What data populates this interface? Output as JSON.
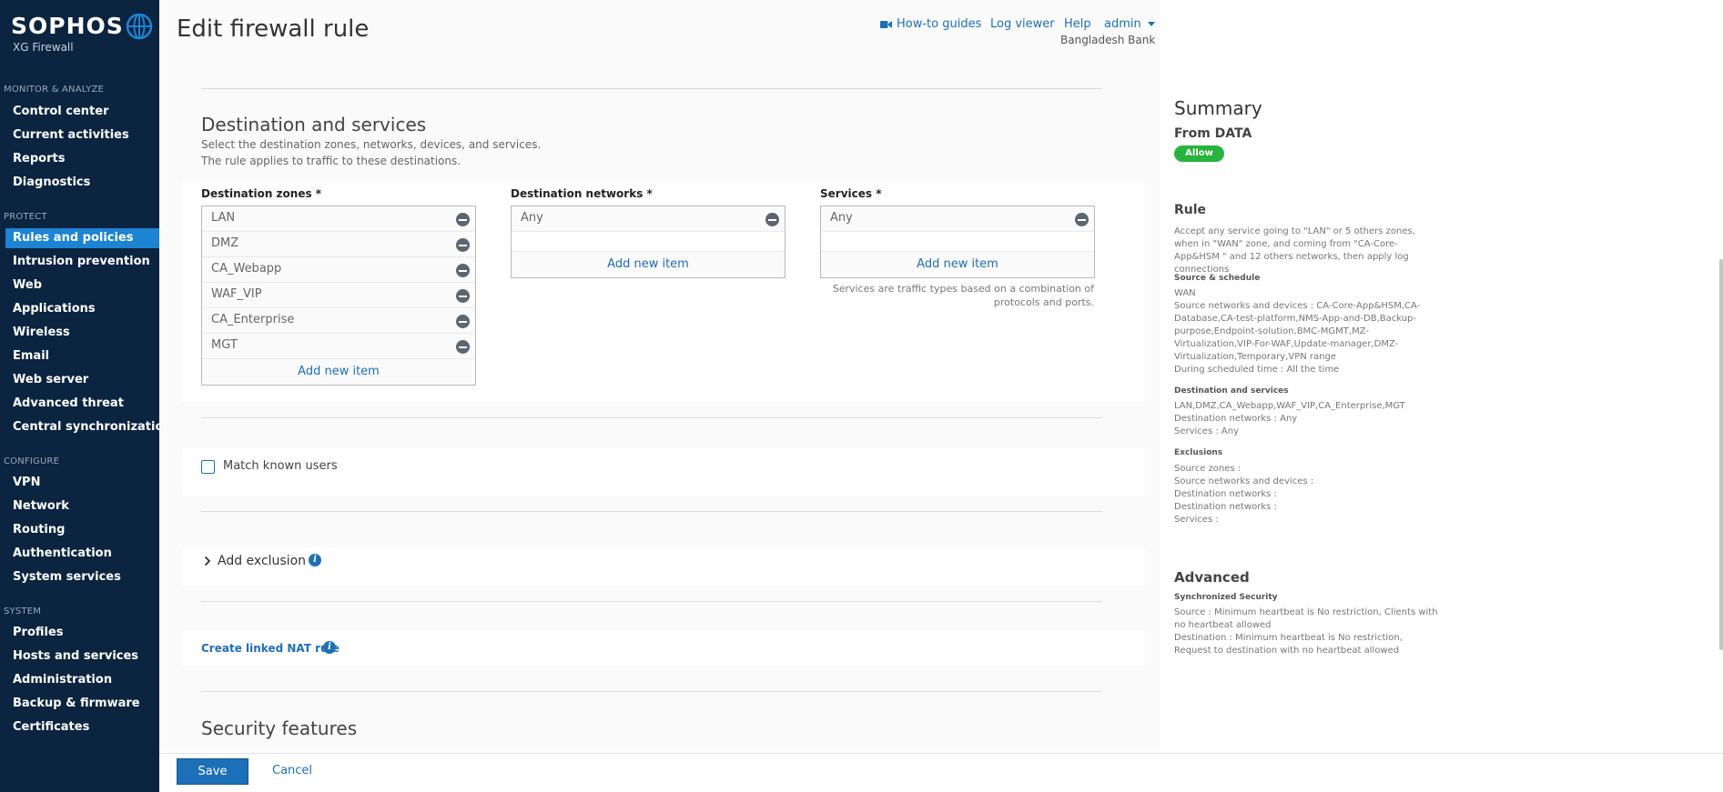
{
  "brand": {
    "name": "SOPHOS",
    "product": "XG Firewall"
  },
  "sidebar": {
    "sections": [
      {
        "label": "MONITOR & ANALYZE",
        "items": [
          "Control center",
          "Current activities",
          "Reports",
          "Diagnostics"
        ]
      },
      {
        "label": "PROTECT",
        "items": [
          "Rules and policies",
          "Intrusion prevention",
          "Web",
          "Applications",
          "Wireless",
          "Email",
          "Web server",
          "Advanced threat",
          "Central synchronization"
        ]
      },
      {
        "label": "CONFIGURE",
        "items": [
          "VPN",
          "Network",
          "Routing",
          "Authentication",
          "System services"
        ]
      },
      {
        "label": "SYSTEM",
        "items": [
          "Profiles",
          "Hosts and services",
          "Administration",
          "Backup & firmware",
          "Certificates"
        ]
      }
    ],
    "active": "Rules and policies"
  },
  "header": {
    "title": "Edit firewall rule",
    "links": {
      "guides": "How-to guides",
      "log": "Log viewer",
      "help": "Help",
      "user": "admin"
    },
    "org": "Bangladesh Bank"
  },
  "destination": {
    "title": "Destination and services",
    "desc1": "Select the destination zones, networks, devices, and services.",
    "desc2": "The rule applies to traffic to these destinations.",
    "zones_label": "Destination zones *",
    "zones": [
      "LAN",
      "DMZ",
      "CA_Webapp",
      "WAF_VIP",
      "CA_Enterprise",
      "MGT"
    ],
    "networks_label": "Destination networks *",
    "networks": [
      "Any"
    ],
    "services_label": "Services *",
    "services": [
      "Any"
    ],
    "add_item": "Add new item",
    "services_note1": "Services are traffic types based on a combination of",
    "services_note2": "protocols and ports."
  },
  "match_users": {
    "label": "Match known users",
    "checked": false
  },
  "exclusion": {
    "label": "Add exclusion"
  },
  "nat": {
    "label": "Create linked NAT rule"
  },
  "security": {
    "title": "Security features"
  },
  "footer": {
    "save": "Save",
    "cancel": "Cancel"
  },
  "summary": {
    "title": "Summary",
    "from": "From DATA",
    "action": "Allow",
    "rule_heading": "Rule",
    "rule_text": "Accept any service going to \"LAN\" or 5 others zones, when in \"WAN\" zone, and coming from \"CA-Core-App&HSM \" and 12 others networks, then apply log connections",
    "source_heading": "Source & schedule",
    "source_zone": "WAN",
    "source_networks": "Source networks and devices : CA-Core-App&HSM,CA-Database,CA-test-platform,NMS-App-and-DB,Backup-purpose,Endpoint-solution,BMC-MGMT,MZ-Virtualization,VIP-For-WAF,Update-manager,DMZ-Virtualization,Temporary,VPN range",
    "schedule": "During scheduled time : All the time",
    "dest_heading": "Destination and services",
    "dest_zones": "LAN,DMZ,CA_Webapp,WAF_VIP,CA_Enterprise,MGT",
    "dest_networks": "Destination networks : Any",
    "dest_services": "Services : Any",
    "excl_heading": "Exclusions",
    "excl_lines": [
      "Source zones :",
      "Source networks and devices :",
      "Destination networks :",
      "Destination networks :",
      "Services :"
    ],
    "adv_heading": "Advanced",
    "sync_heading": "Synchronized Security",
    "sync_source": "Source : Minimum heartbeat is No restriction, Clients with no heartbeat allowed",
    "sync_dest": "Destination : Minimum heartbeat is No restriction, Request to destination with no heartbeat allowed"
  },
  "colors": {
    "sidebar": "#0b2440",
    "accent": "#1d6fb8",
    "active": "#1d83d3",
    "allow": "#28b43c"
  }
}
